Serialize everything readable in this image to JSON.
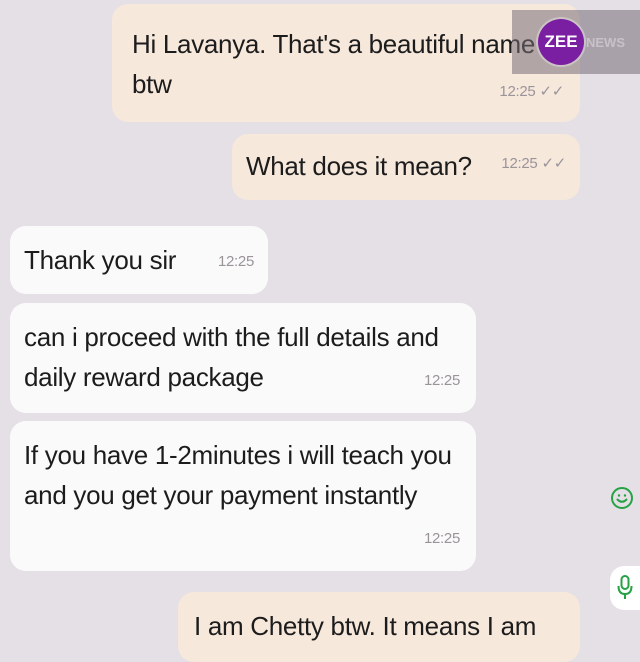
{
  "messages": [
    {
      "direction": "outgoing",
      "text": "Hi Lavanya. That's a beautiful name\nbtw",
      "time": "12:25",
      "status_icon": "double-check-icon"
    },
    {
      "direction": "outgoing",
      "text": "What does it mean?",
      "time": "12:25",
      "status_icon": "double-check-icon"
    },
    {
      "direction": "incoming",
      "text": "Thank you sir",
      "time": "12:25"
    },
    {
      "direction": "incoming",
      "text": "can i proceed with the full details and\ndaily reward package",
      "time": "12:25"
    },
    {
      "direction": "incoming",
      "text": "If you have 1-2minutes i will teach you\nand you get your payment instantly",
      "time": "12:25"
    },
    {
      "direction": "outgoing",
      "text": "I am Chetty btw. It means I am"
    }
  ],
  "watermark": {
    "logo_text": "ZEE",
    "suffix_text": "NEWS",
    "logo_color": "#7b1fa2"
  },
  "icons": {
    "ticks": "✓✓",
    "reaction": "smiley-icon",
    "mic": "mic-icon"
  },
  "colors": {
    "background": "#e5dfe6",
    "outgoing_bubble": "#f7e8dc",
    "incoming_bubble": "#fbfafb",
    "accent_green": "#25a244"
  }
}
